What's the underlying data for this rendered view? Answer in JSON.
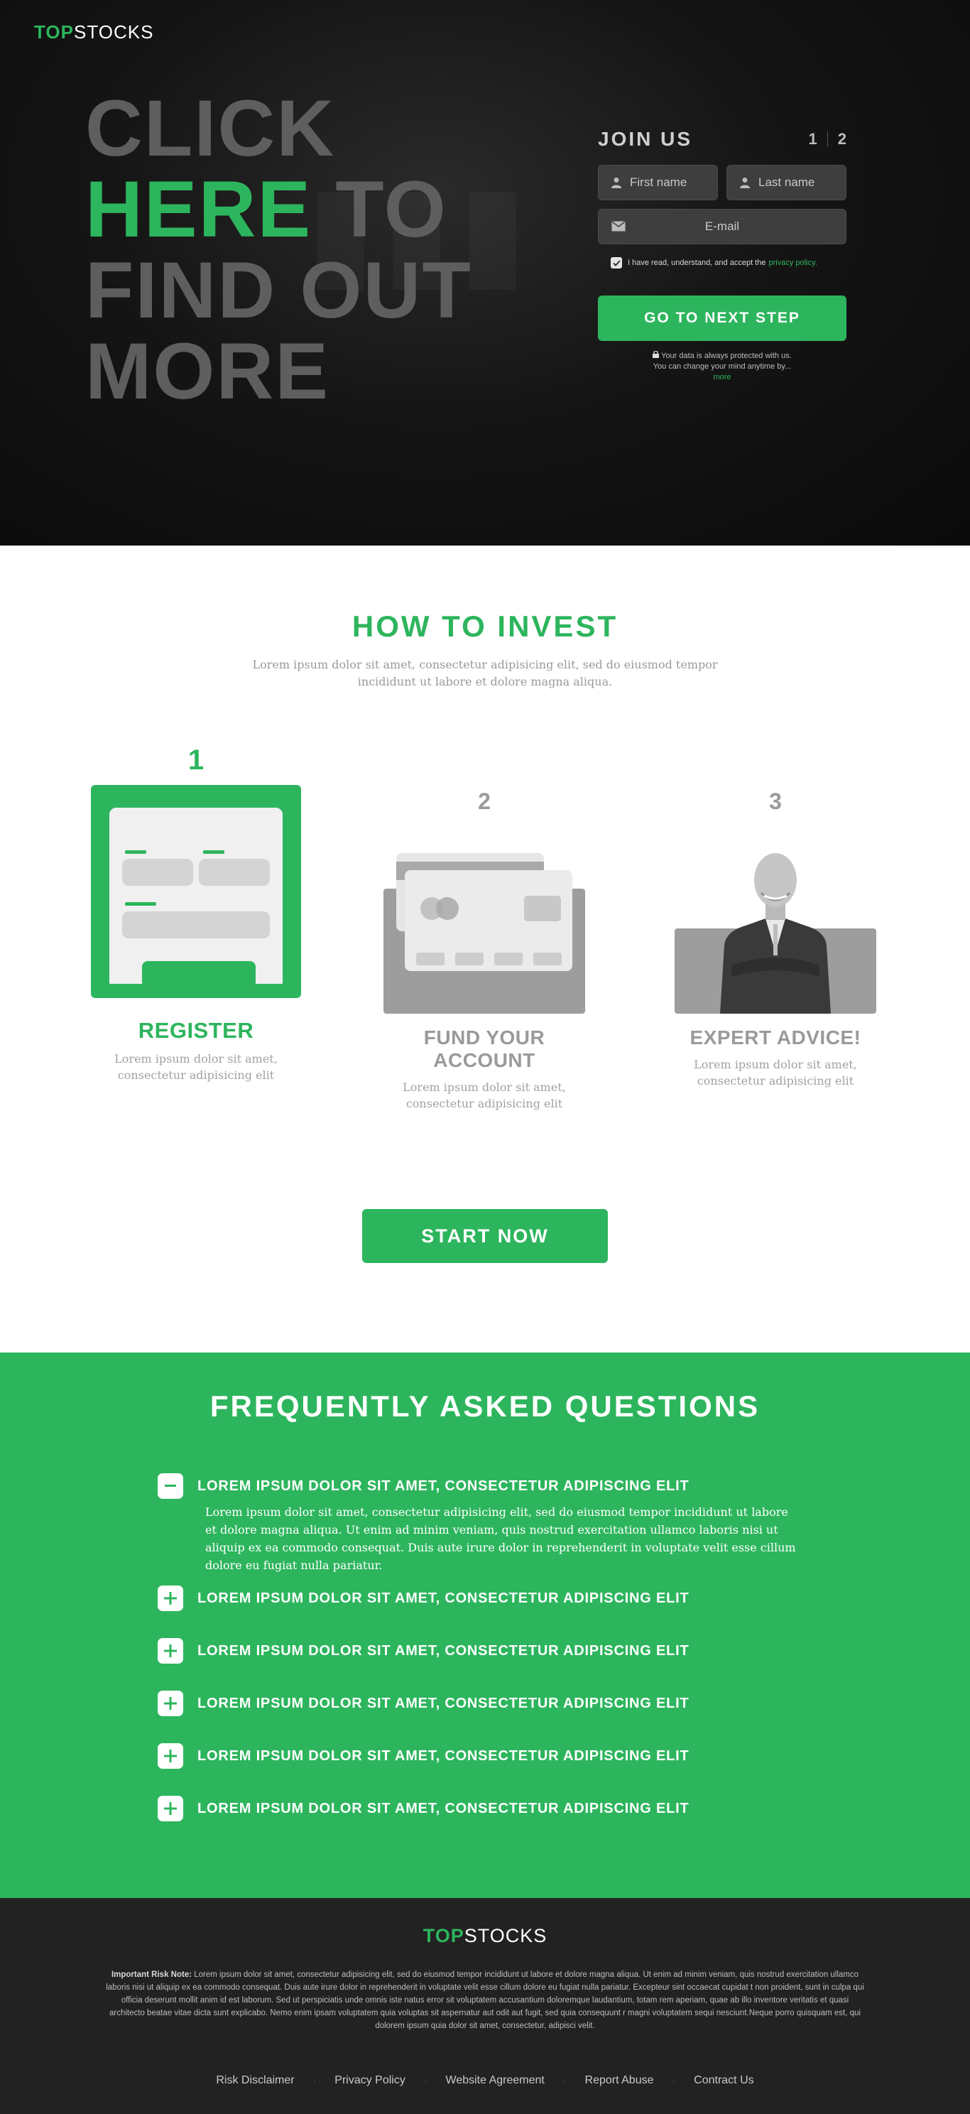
{
  "brand": {
    "top": "TOP",
    "stocks": "STOCKS"
  },
  "hero": {
    "headline_line1": "CLICK",
    "headline_green": "HERE",
    "headline_line2_rest": " TO",
    "headline_line3": "FIND OUT",
    "headline_line4": "MORE"
  },
  "join": {
    "title": "JOIN US",
    "step_1": "1",
    "step_2": "2",
    "first_name_placeholder": "First name",
    "last_name_placeholder": "Last name",
    "email_placeholder": "E-mail",
    "consent_text": "I have read, understand, and accept the",
    "privacy_link": "privacy policy.",
    "next_button": "GO TO NEXT STEP",
    "privacy_line1": "Your data is always protected with us.",
    "privacy_line2": "You can change your mind anytime by...",
    "privacy_more": "more"
  },
  "invest": {
    "title": "HOW TO INVEST",
    "subtitle": "Lorem ipsum dolor sit amet, consectetur adipisicing elit, sed do eiusmod tempor incididunt ut labore et dolore magna aliqua.",
    "steps": [
      {
        "number": "1",
        "title": "REGISTER",
        "desc": "Lorem ipsum dolor sit amet, consectetur adipisicing elit"
      },
      {
        "number": "2",
        "title": "FUND YOUR ACCOUNT",
        "desc": "Lorem ipsum dolor sit amet, consectetur adipisicing elit"
      },
      {
        "number": "3",
        "title": "EXPERT ADVICE!",
        "desc": "Lorem ipsum dolor sit amet, consectetur adipisicing elit"
      }
    ],
    "start_button": "START NOW"
  },
  "faq": {
    "title": "FREQUENTLY ASKED QUESTIONS",
    "items": [
      {
        "question": "LOREM IPSUM DOLOR SIT AMET, CONSECTETUR ADIPISCING ELIT",
        "answer": "Lorem ipsum dolor sit amet, consectetur adipisicing elit, sed do eiusmod tempor incididunt ut labore et dolore magna aliqua. Ut enim ad minim veniam, quis nostrud exercitation ullamco laboris nisi ut aliquip ex ea commodo consequat. Duis aute irure dolor in reprehenderit in voluptate velit esse cillum dolore eu fugiat nulla pariatur."
      },
      {
        "question": "LOREM IPSUM DOLOR SIT AMET, CONSECTETUR ADIPISCING ELIT"
      },
      {
        "question": "LOREM IPSUM DOLOR SIT AMET, CONSECTETUR ADIPISCING ELIT"
      },
      {
        "question": "LOREM IPSUM DOLOR SIT AMET, CONSECTETUR ADIPISCING ELIT"
      },
      {
        "question": "LOREM IPSUM DOLOR SIT AMET, CONSECTETUR ADIPISCING ELIT"
      },
      {
        "question": "LOREM IPSUM DOLOR SIT AMET, CONSECTETUR ADIPISCING ELIT"
      }
    ]
  },
  "footer": {
    "risk_label": "Important Risk Note:",
    "risk_text": " Lorem ipsum dolor sit amet, consectetur adipisicing elit, sed do eiusmod tempor incididunt ut labore et dolore magna aliqua. Ut enim ad minim veniam, quis nostrud exercitation ullamco laboris nisi ut aliquip ex ea commodo consequat. Duis aute irure dolor in reprehenderit in voluptate velit esse cillum dolore eu fugiat nulla pariatur. Excepteur sint occaecat cupidat t non proident, sunt in culpa qui officia deserunt mollit anim id est laborum. Sed ut perspiciatis unde omnis iste natus error sit voluptatem accusantium doloremque laudantium, totam rem aperiam, quae ab illo inventore veritatis et quasi architecto beatae vitae dicta sunt explicabo. Nemo enim ipsam voluptatem quia voluptas sit aspernatur aut odit aut fugit, sed quia consequunt r magni voluptatem sequi nesciunt.Neque porro quisquam est, qui dolorem ipsum quia dolor sit amet, consectetur, adipisci velit.",
    "links": [
      "Risk Disclaimer",
      "Privacy Policy",
      "Website Agreement",
      "Report Abuse",
      "Contract Us"
    ]
  },
  "colors": {
    "accent": "#2db55d",
    "hero_bg": "#121212",
    "footer_bg": "#222222",
    "muted": "#9a9a9a"
  }
}
